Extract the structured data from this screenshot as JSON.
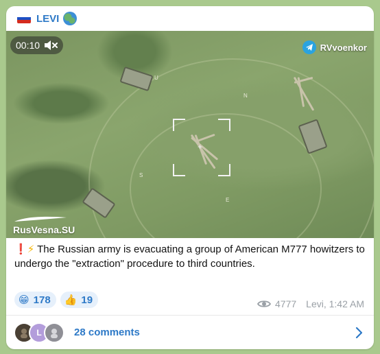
{
  "header": {
    "title": "LEVI",
    "flag_icon": "russian-flag-icon",
    "globe_icon": "globe-icon"
  },
  "media": {
    "timer": "00:10",
    "mute_icon": "speaker-muted-icon",
    "source_channel": "RVvoenkor",
    "source_icon": "telegram-icon",
    "watermark": "RusVesna.SU",
    "field_marks": [
      "U",
      "N",
      "S",
      "E"
    ]
  },
  "message": {
    "prefix_icons": [
      "exclamation-icon",
      "lightning-icon"
    ],
    "text": "The Russian army is evacuating a group of American M777 howitzers to undergo the \"extraction\" procedure to third countries."
  },
  "reactions": [
    {
      "emoji": "😁",
      "icon": "grinning-face-icon",
      "count": "178"
    },
    {
      "emoji": "👍",
      "icon": "thumbs-up-icon",
      "count": "19"
    }
  ],
  "meta": {
    "views": "4777",
    "author_time": "Levi, 1:42 AM",
    "eye_icon": "eye-icon"
  },
  "comments": {
    "label": "28 comments",
    "avatars": [
      {
        "letter": "",
        "color": "#4a4034"
      },
      {
        "letter": "L",
        "color": "#b39ddb"
      },
      {
        "letter": "",
        "color": "#8f8f96"
      }
    ],
    "chevron_icon": "chevron-right-icon"
  },
  "colors": {
    "accent": "#2d79c7",
    "background": "#a9c98d",
    "reaction_bg": "#e6f0fb",
    "meta_text": "#9aa0a6"
  }
}
